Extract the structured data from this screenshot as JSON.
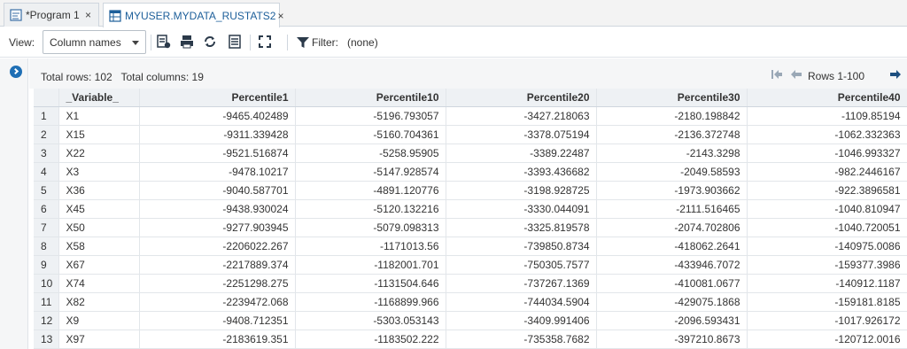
{
  "tabs": [
    {
      "label": "*Program 1",
      "close": "×"
    },
    {
      "label": "MYUSER.MYDATA_RUSTATS2",
      "close": "×"
    }
  ],
  "toolbar": {
    "view_label": "View:",
    "view_value": "Column names",
    "filter_label": "Filter:",
    "filter_value": "(none)"
  },
  "info": {
    "summary": "Total rows: 102   Total columns: 19",
    "rows_range": "Rows 1-100"
  },
  "table": {
    "columns": [
      "_Variable_",
      "Percentile1",
      "Percentile10",
      "Percentile20",
      "Percentile30",
      "Percentile40"
    ],
    "rows": [
      [
        "1",
        "X1",
        "-9465.402489",
        "-5196.793057",
        "-3427.218063",
        "-2180.198842",
        "-1109.85194"
      ],
      [
        "2",
        "X15",
        "-9311.339428",
        "-5160.704361",
        "-3378.075194",
        "-2136.372748",
        "-1062.332363"
      ],
      [
        "3",
        "X22",
        "-9521.516874",
        "-5258.95905",
        "-3389.22487",
        "-2143.3298",
        "-1046.993327"
      ],
      [
        "4",
        "X3",
        "-9478.10217",
        "-5147.928574",
        "-3393.436682",
        "-2049.58593",
        "-982.2446167"
      ],
      [
        "5",
        "X36",
        "-9040.587701",
        "-4891.120776",
        "-3198.928725",
        "-1973.903662",
        "-922.3896581"
      ],
      [
        "6",
        "X45",
        "-9438.930024",
        "-5120.132216",
        "-3330.044091",
        "-2111.516465",
        "-1040.810947"
      ],
      [
        "7",
        "X50",
        "-9277.903945",
        "-5079.098313",
        "-3325.819578",
        "-2074.702806",
        "-1040.720051"
      ],
      [
        "8",
        "X58",
        "-2206022.267",
        "-1171013.56",
        "-739850.8734",
        "-418062.2641",
        "-140975.0086"
      ],
      [
        "9",
        "X67",
        "-2217889.374",
        "-1182001.701",
        "-750305.7577",
        "-433946.7072",
        "-159377.3986"
      ],
      [
        "10",
        "X74",
        "-2251298.275",
        "-1131504.646",
        "-737267.1369",
        "-410081.0677",
        "-140912.1187"
      ],
      [
        "11",
        "X82",
        "-2239472.068",
        "-1168899.966",
        "-744034.5904",
        "-429075.1868",
        "-159181.8185"
      ],
      [
        "12",
        "X9",
        "-9408.712351",
        "-5303.053143",
        "-3409.991406",
        "-2096.593431",
        "-1017.926172"
      ],
      [
        "13",
        "X97",
        "-2183619.351",
        "-1183502.222",
        "-735358.7682",
        "-397210.8673",
        "-120712.0016"
      ]
    ]
  },
  "colors": {
    "accent": "#1f6fb5",
    "header_bg": "#eef1f4",
    "border": "#e2e6ea"
  }
}
